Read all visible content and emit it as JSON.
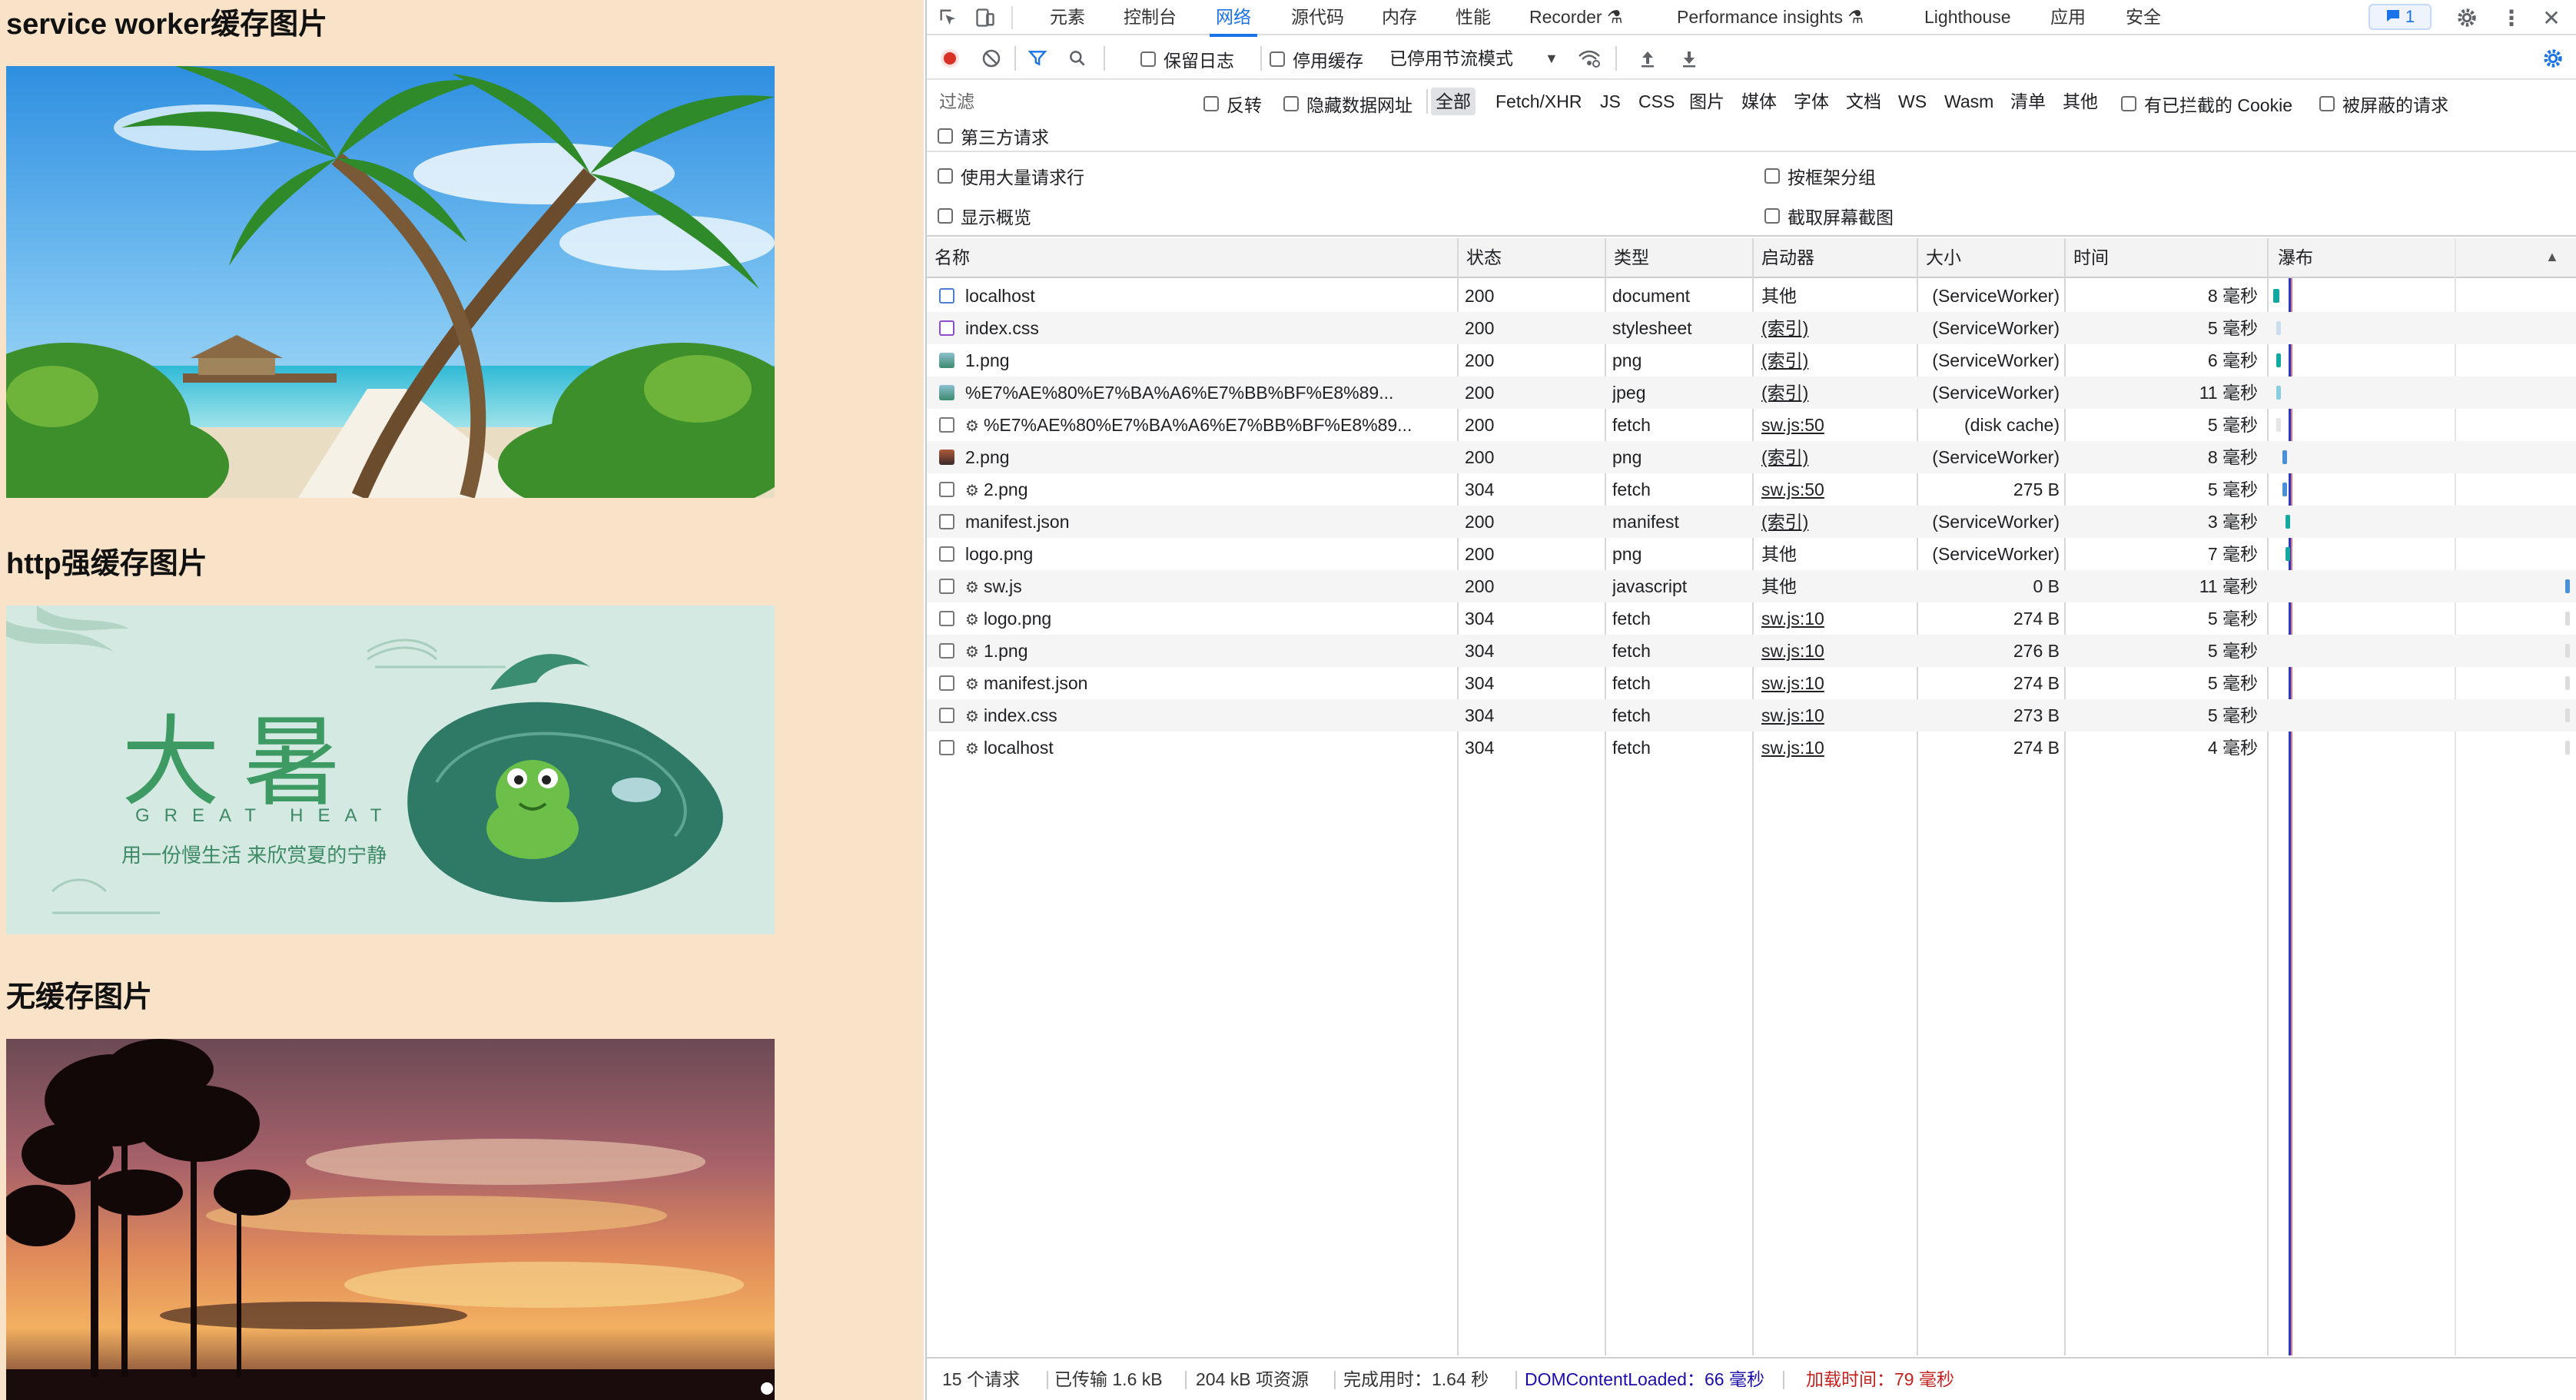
{
  "page": {
    "heading1": "service worker缓存图片",
    "heading2": "http强缓存图片",
    "heading3": "无缓存图片",
    "banner": {
      "title": "大暑",
      "subtitle": "GREAT HEAT",
      "tagline": "用一份慢生活 来欣赏夏的宁静"
    }
  },
  "devtools": {
    "tabs": [
      "元素",
      "控制台",
      "网络",
      "源代码",
      "内存",
      "性能",
      "Recorder",
      "Performance insights",
      "Lighthouse",
      "应用",
      "安全"
    ],
    "active_tab": "网络",
    "issues_badge": "1",
    "toolbar": {
      "preserve_log": "保留日志",
      "disable_cache": "停用缓存",
      "throttle": "已停用节流模式"
    },
    "filter": {
      "placeholder": "过滤",
      "invert": "反转",
      "hide_data_urls": "隐藏数据网址",
      "types": [
        "全部",
        "Fetch/XHR",
        "JS",
        "CSS",
        "图片",
        "媒体",
        "字体",
        "文档",
        "WS",
        "Wasm",
        "清单",
        "其他"
      ],
      "active_type": "全部",
      "blocked_cookies": "有已拦截的 Cookie",
      "blocked_requests": "被屏蔽的请求",
      "third_party": "第三方请求"
    },
    "options": {
      "large_rows": "使用大量请求行",
      "group_by_frame": "按框架分组",
      "show_overview": "显示概览",
      "capture_screenshots": "截取屏幕截图"
    },
    "columns": {
      "name": "名称",
      "status": "状态",
      "type": "类型",
      "initiator": "启动器",
      "size": "大小",
      "time": "时间",
      "waterfall": "瀑布"
    },
    "requests": [
      {
        "name": "localhost",
        "sw": false,
        "icon": "document",
        "status": "200",
        "type": "document",
        "initiator": "其他",
        "initiator_link": false,
        "size": "(ServiceWorker)",
        "time": "8 毫秒",
        "wf_start": 0.01,
        "wf_len": 0.02,
        "wf_color": "#13a8a0"
      },
      {
        "name": "index.css",
        "sw": false,
        "icon": "stylesheet",
        "status": "200",
        "type": "stylesheet",
        "initiator": "(索引)",
        "initiator_link": true,
        "size": "(ServiceWorker)",
        "time": "5 毫秒",
        "wf_start": 0.02,
        "wf_len": 0.01,
        "wf_color": "#cde"
      },
      {
        "name": "1.png",
        "sw": false,
        "icon": "image",
        "status": "200",
        "type": "png",
        "initiator": "(索引)",
        "initiator_link": true,
        "size": "(ServiceWorker)",
        "time": "6 毫秒",
        "wf_start": 0.02,
        "wf_len": 0.01,
        "wf_color": "#13a8a0"
      },
      {
        "name": "%E7%AE%80%E7%BA%A6%E7%BB%BF%E8%89...",
        "sw": false,
        "icon": "image",
        "status": "200",
        "type": "jpeg",
        "initiator": "(索引)",
        "initiator_link": true,
        "size": "(ServiceWorker)",
        "time": "11 毫秒",
        "wf_start": 0.02,
        "wf_len": 0.01,
        "wf_color": "#8cd"
      },
      {
        "name": "%E7%AE%80%E7%BA%A6%E7%BB%BF%E8%89...",
        "sw": true,
        "icon": "fetch",
        "status": "200",
        "type": "fetch",
        "initiator": "sw.js:50",
        "initiator_link": true,
        "size": "(disk cache)",
        "time": "5 毫秒",
        "wf_start": 0.02,
        "wf_len": 0.01,
        "wf_color": "#e6e6e6"
      },
      {
        "name": "2.png",
        "sw": false,
        "icon": "image2",
        "status": "200",
        "type": "png",
        "initiator": "(索引)",
        "initiator_link": true,
        "size": "(ServiceWorker)",
        "time": "8 毫秒",
        "wf_start": 0.04,
        "wf_len": 0.01,
        "wf_color": "#4a90d9"
      },
      {
        "name": "2.png",
        "sw": true,
        "icon": "fetch",
        "status": "304",
        "type": "fetch",
        "initiator": "sw.js:50",
        "initiator_link": true,
        "size": "275 B",
        "time": "5 毫秒",
        "wf_start": 0.04,
        "wf_len": 0.01,
        "wf_color": "#4a90d9"
      },
      {
        "name": "manifest.json",
        "sw": false,
        "icon": "blank",
        "status": "200",
        "type": "manifest",
        "initiator": "(索引)",
        "initiator_link": true,
        "size": "(ServiceWorker)",
        "time": "3 毫秒",
        "wf_start": 0.05,
        "wf_len": 0.01,
        "wf_color": "#13a8a0"
      },
      {
        "name": "logo.png",
        "sw": false,
        "icon": "blank",
        "status": "200",
        "type": "png",
        "initiator": "其他",
        "initiator_link": false,
        "size": "(ServiceWorker)",
        "time": "7 毫秒",
        "wf_start": 0.05,
        "wf_len": 0.01,
        "wf_color": "#13a8a0"
      },
      {
        "name": "sw.js",
        "sw": true,
        "icon": "blank",
        "status": "200",
        "type": "javascript",
        "initiator": "其他",
        "initiator_link": false,
        "size": "0 B",
        "time": "11 毫秒",
        "wf_start": 0.99,
        "wf_len": 0.01,
        "wf_color": "#4a90d9"
      },
      {
        "name": "logo.png",
        "sw": true,
        "icon": "fetch",
        "status": "304",
        "type": "fetch",
        "initiator": "sw.js:10",
        "initiator_link": true,
        "size": "274 B",
        "time": "5 毫秒",
        "wf_start": 0.99,
        "wf_len": 0.01,
        "wf_color": "#ddd"
      },
      {
        "name": "1.png",
        "sw": true,
        "icon": "fetch",
        "status": "304",
        "type": "fetch",
        "initiator": "sw.js:10",
        "initiator_link": true,
        "size": "276 B",
        "time": "5 毫秒",
        "wf_start": 0.99,
        "wf_len": 0.01,
        "wf_color": "#ddd"
      },
      {
        "name": "manifest.json",
        "sw": true,
        "icon": "fetch",
        "status": "304",
        "type": "fetch",
        "initiator": "sw.js:10",
        "initiator_link": true,
        "size": "274 B",
        "time": "5 毫秒",
        "wf_start": 0.99,
        "wf_len": 0.01,
        "wf_color": "#ddd"
      },
      {
        "name": "index.css",
        "sw": true,
        "icon": "fetch",
        "status": "304",
        "type": "fetch",
        "initiator": "sw.js:10",
        "initiator_link": true,
        "size": "273 B",
        "time": "5 毫秒",
        "wf_start": 0.99,
        "wf_len": 0.01,
        "wf_color": "#ddd"
      },
      {
        "name": "localhost",
        "sw": true,
        "icon": "fetch",
        "status": "304",
        "type": "fetch",
        "initiator": "sw.js:10",
        "initiator_link": true,
        "size": "274 B",
        "time": "4 毫秒",
        "wf_start": 0.99,
        "wf_len": 0.01,
        "wf_color": "#ddd"
      }
    ],
    "status": {
      "requests": "15 个请求",
      "transferred": "已传输 1.6 kB",
      "resources": "204 kB 项资源",
      "finish": "完成用时：1.64 秒",
      "dom_loaded": "DOMContentLoaded：66 毫秒",
      "load": "加载时间：79 毫秒"
    },
    "colors": {
      "accent": "#1a73e8",
      "record": "#d93025",
      "dom_loaded": "#1a0dab",
      "load": "#c5221f"
    }
  }
}
